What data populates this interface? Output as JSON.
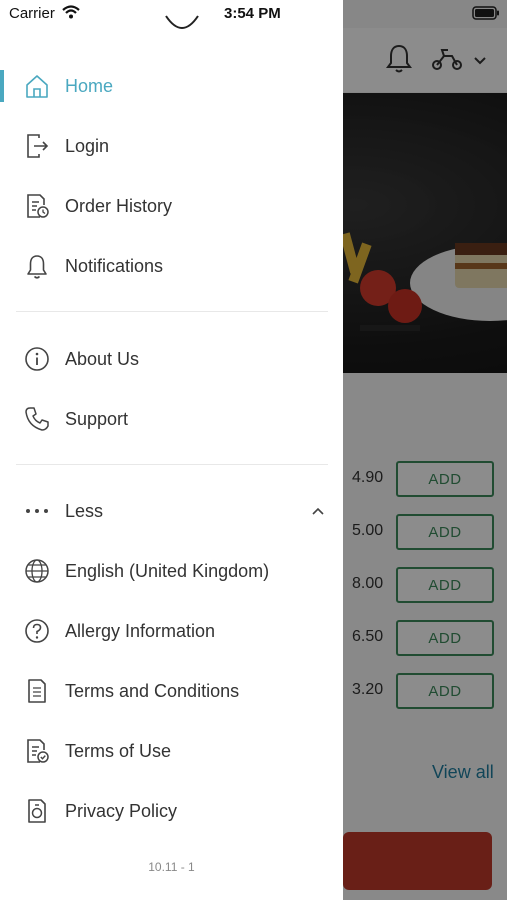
{
  "status_bar": {
    "carrier": "Carrier",
    "time": "3:54 PM"
  },
  "background": {
    "prices": [
      "4.90",
      "5.00",
      "8.00",
      "6.50",
      "3.20"
    ],
    "add_label": "ADD",
    "view_all": "View all"
  },
  "drawer": {
    "items": [
      {
        "label": "Home",
        "icon": "home-icon"
      },
      {
        "label": "Login",
        "icon": "login-icon"
      },
      {
        "label": "Order History",
        "icon": "order-history-icon"
      },
      {
        "label": "Notifications",
        "icon": "bell-icon"
      },
      {
        "label": "About Us",
        "icon": "info-icon"
      },
      {
        "label": "Support",
        "icon": "phone-icon"
      },
      {
        "label": "Less",
        "icon": "more-dots-icon"
      },
      {
        "label": "English (United Kingdom)",
        "icon": "globe-icon"
      },
      {
        "label": "Allergy Information",
        "icon": "question-icon"
      },
      {
        "label": "Terms and Conditions",
        "icon": "document-icon"
      },
      {
        "label": "Terms of Use",
        "icon": "document-check-icon"
      },
      {
        "label": "Privacy Policy",
        "icon": "privacy-icon"
      }
    ],
    "version": "10.11 - 1"
  },
  "colors": {
    "accent": "#4aa8c0",
    "add_button": "#3d8a5c",
    "link": "#1f7fa0",
    "cta": "#c0392b"
  }
}
